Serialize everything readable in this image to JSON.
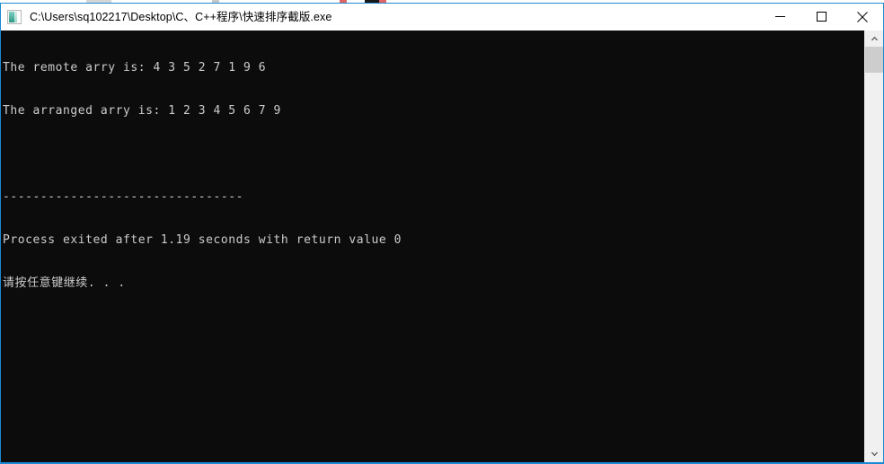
{
  "window": {
    "title": "C:\\Users\\sq102217\\Desktop\\C、C++程序\\快速排序截版.exe",
    "icon_name": "console-app-icon",
    "border_color": "#1a8ad4",
    "titlebar_bg": "#ffffff",
    "controls": {
      "minimize_label": "Minimize",
      "maximize_label": "Maximize",
      "close_label": "Close"
    }
  },
  "console": {
    "background": "#0c0c0c",
    "foreground": "#cccccc",
    "lines": [
      "The remote arry is: 4 3 5 2 7 1 9 6",
      "The arranged arry is: 1 2 3 4 5 6 7 9",
      "",
      "--------------------------------",
      "Process exited after 1.19 seconds with return value 0",
      "请按任意键继续. . ."
    ],
    "program_output": {
      "remote_array_label": "The remote arry is:",
      "remote_array": [
        4,
        3,
        5,
        2,
        7,
        1,
        9,
        6
      ],
      "arranged_array_label": "The arranged arry is:",
      "arranged_array": [
        1,
        2,
        3,
        4,
        5,
        6,
        7,
        9
      ],
      "separator": "--------------------------------",
      "exit_message": "Process exited after 1.19 seconds with return value 0",
      "elapsed_seconds": "1.19",
      "return_value": "0",
      "press_any_key": "请按任意键继续. . ."
    }
  },
  "scrollbar": {
    "up_arrow": "scroll-up-arrow-icon",
    "down_arrow": "scroll-down-arrow-icon",
    "thumb_color": "#cdcdcd",
    "track_color": "#f0f0f0"
  }
}
